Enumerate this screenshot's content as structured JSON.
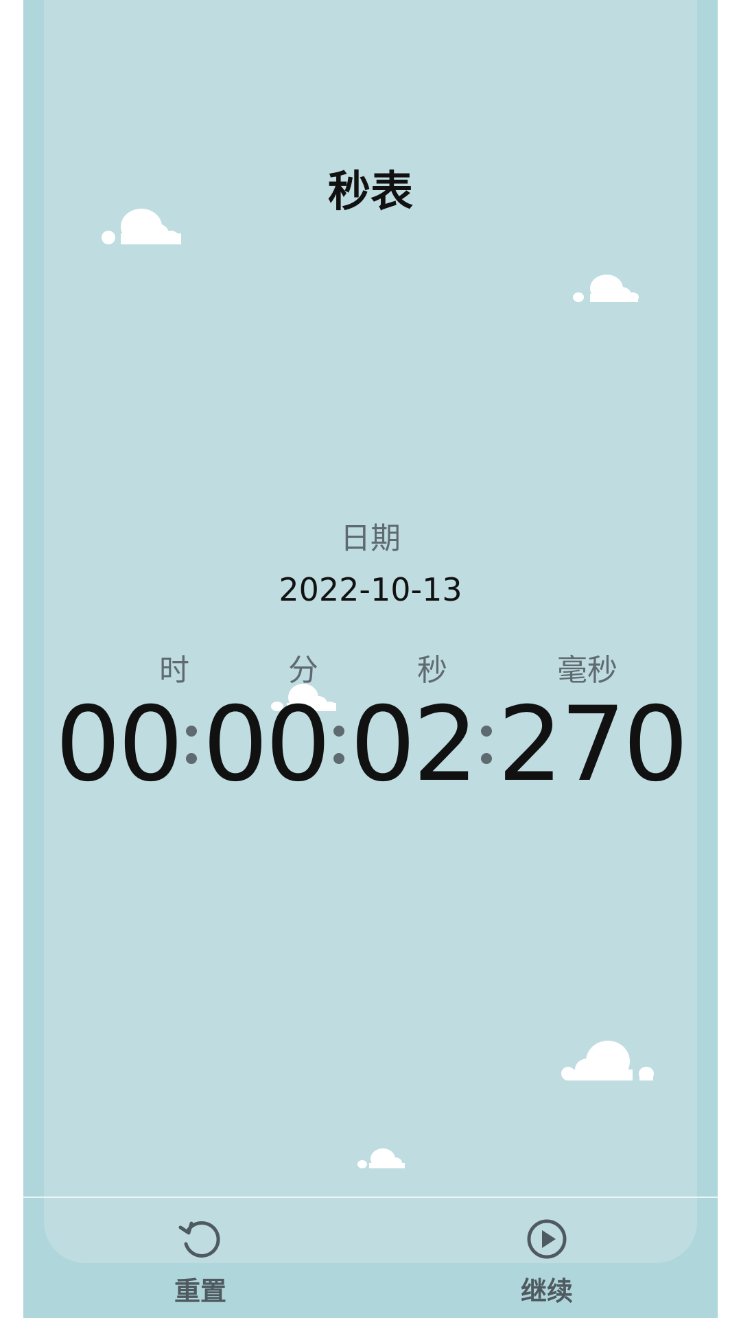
{
  "header": {
    "title": "秒表"
  },
  "date": {
    "label": "日期",
    "value": "2022-10-13"
  },
  "units": {
    "hour": "时",
    "minute": "分",
    "second": "秒",
    "millisecond": "毫秒"
  },
  "timer": {
    "hours": "00",
    "minutes": "00",
    "seconds": "02",
    "milliseconds": "270"
  },
  "actions": {
    "reset": {
      "label": "重置",
      "icon": "reset-icon"
    },
    "resume": {
      "label": "继续",
      "icon": "play-circle-icon"
    }
  },
  "colors": {
    "background": "#bfdce1",
    "frame": "#aed6db",
    "text": "#111111",
    "muted": "#5f6a70"
  }
}
